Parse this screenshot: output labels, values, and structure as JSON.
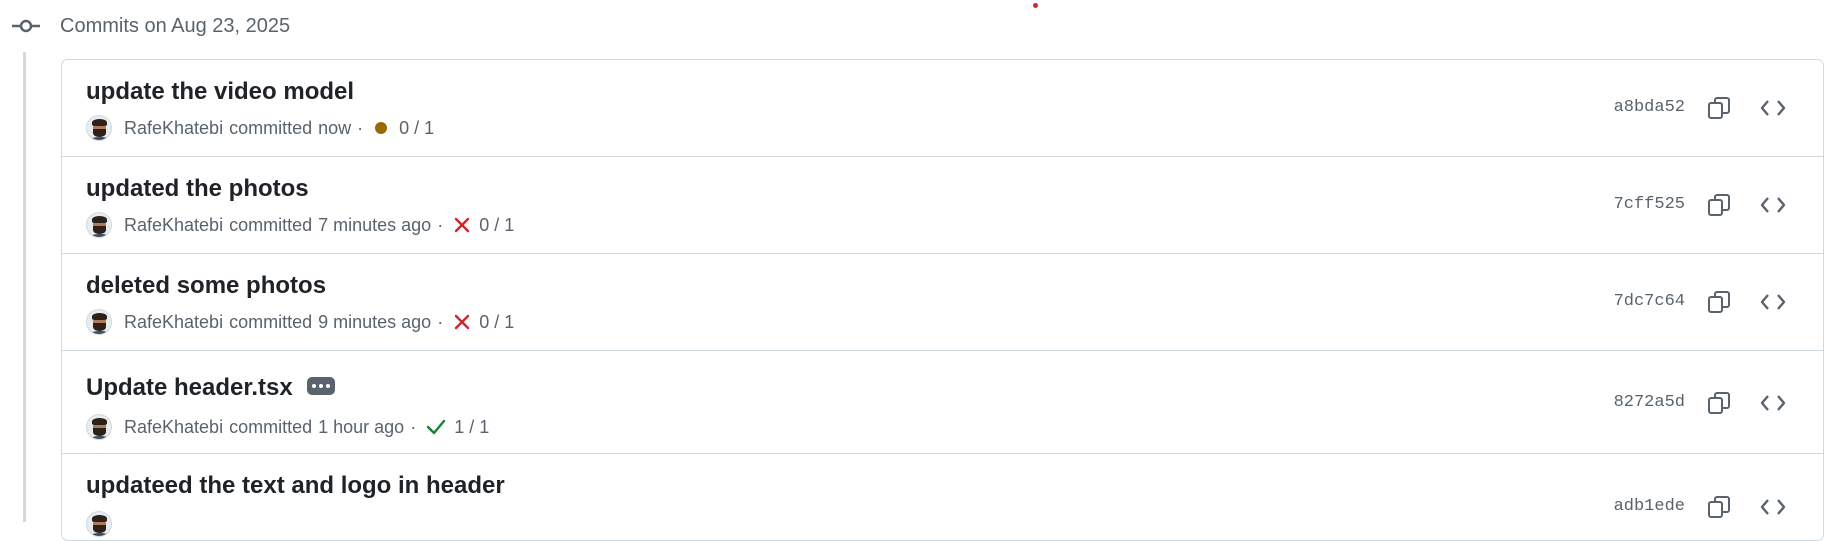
{
  "group": {
    "title": "Commits on Aug 23, 2025"
  },
  "commits": [
    {
      "title": "update the video model",
      "author": "RafeKhatebi",
      "action": "committed",
      "time": "now",
      "status": "pending",
      "checks": "0 / 1",
      "sha": "a8bda52"
    },
    {
      "title": "updated the photos",
      "author": "RafeKhatebi",
      "action": "committed",
      "time": "7 minutes ago",
      "status": "failure",
      "checks": "0 / 1",
      "sha": "7cff525"
    },
    {
      "title": "deleted some photos",
      "author": "RafeKhatebi",
      "action": "committed",
      "time": "9 minutes ago",
      "status": "failure",
      "checks": "0 / 1",
      "sha": "7dc7c64"
    },
    {
      "title": "Update header.tsx",
      "author": "RafeKhatebi",
      "action": "committed",
      "time": "1 hour ago",
      "status": "success",
      "checks": "1 / 1",
      "sha": "8272a5d"
    },
    {
      "title": "updateed the text and logo in header",
      "sha": "adb1ede"
    }
  ],
  "colors": {
    "pending": "#9a6700",
    "failure": "#d1242f",
    "success": "#1a7f37",
    "border": "#d1d9e0",
    "muted": "#59636e"
  }
}
